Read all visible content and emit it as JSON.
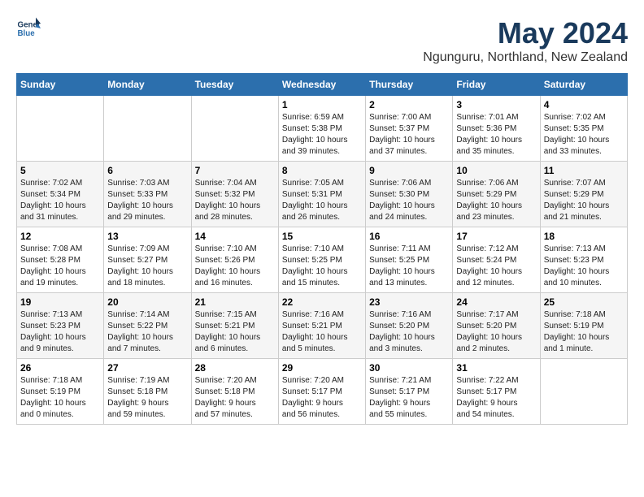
{
  "header": {
    "logo_line1": "General",
    "logo_line2": "Blue",
    "month": "May 2024",
    "location": "Ngunguru, Northland, New Zealand"
  },
  "weekdays": [
    "Sunday",
    "Monday",
    "Tuesday",
    "Wednesday",
    "Thursday",
    "Friday",
    "Saturday"
  ],
  "weeks": [
    [
      {
        "day": "",
        "info": ""
      },
      {
        "day": "",
        "info": ""
      },
      {
        "day": "",
        "info": ""
      },
      {
        "day": "1",
        "info": "Sunrise: 6:59 AM\nSunset: 5:38 PM\nDaylight: 10 hours\nand 39 minutes."
      },
      {
        "day": "2",
        "info": "Sunrise: 7:00 AM\nSunset: 5:37 PM\nDaylight: 10 hours\nand 37 minutes."
      },
      {
        "day": "3",
        "info": "Sunrise: 7:01 AM\nSunset: 5:36 PM\nDaylight: 10 hours\nand 35 minutes."
      },
      {
        "day": "4",
        "info": "Sunrise: 7:02 AM\nSunset: 5:35 PM\nDaylight: 10 hours\nand 33 minutes."
      }
    ],
    [
      {
        "day": "5",
        "info": "Sunrise: 7:02 AM\nSunset: 5:34 PM\nDaylight: 10 hours\nand 31 minutes."
      },
      {
        "day": "6",
        "info": "Sunrise: 7:03 AM\nSunset: 5:33 PM\nDaylight: 10 hours\nand 29 minutes."
      },
      {
        "day": "7",
        "info": "Sunrise: 7:04 AM\nSunset: 5:32 PM\nDaylight: 10 hours\nand 28 minutes."
      },
      {
        "day": "8",
        "info": "Sunrise: 7:05 AM\nSunset: 5:31 PM\nDaylight: 10 hours\nand 26 minutes."
      },
      {
        "day": "9",
        "info": "Sunrise: 7:06 AM\nSunset: 5:30 PM\nDaylight: 10 hours\nand 24 minutes."
      },
      {
        "day": "10",
        "info": "Sunrise: 7:06 AM\nSunset: 5:29 PM\nDaylight: 10 hours\nand 23 minutes."
      },
      {
        "day": "11",
        "info": "Sunrise: 7:07 AM\nSunset: 5:29 PM\nDaylight: 10 hours\nand 21 minutes."
      }
    ],
    [
      {
        "day": "12",
        "info": "Sunrise: 7:08 AM\nSunset: 5:28 PM\nDaylight: 10 hours\nand 19 minutes."
      },
      {
        "day": "13",
        "info": "Sunrise: 7:09 AM\nSunset: 5:27 PM\nDaylight: 10 hours\nand 18 minutes."
      },
      {
        "day": "14",
        "info": "Sunrise: 7:10 AM\nSunset: 5:26 PM\nDaylight: 10 hours\nand 16 minutes."
      },
      {
        "day": "15",
        "info": "Sunrise: 7:10 AM\nSunset: 5:25 PM\nDaylight: 10 hours\nand 15 minutes."
      },
      {
        "day": "16",
        "info": "Sunrise: 7:11 AM\nSunset: 5:25 PM\nDaylight: 10 hours\nand 13 minutes."
      },
      {
        "day": "17",
        "info": "Sunrise: 7:12 AM\nSunset: 5:24 PM\nDaylight: 10 hours\nand 12 minutes."
      },
      {
        "day": "18",
        "info": "Sunrise: 7:13 AM\nSunset: 5:23 PM\nDaylight: 10 hours\nand 10 minutes."
      }
    ],
    [
      {
        "day": "19",
        "info": "Sunrise: 7:13 AM\nSunset: 5:23 PM\nDaylight: 10 hours\nand 9 minutes."
      },
      {
        "day": "20",
        "info": "Sunrise: 7:14 AM\nSunset: 5:22 PM\nDaylight: 10 hours\nand 7 minutes."
      },
      {
        "day": "21",
        "info": "Sunrise: 7:15 AM\nSunset: 5:21 PM\nDaylight: 10 hours\nand 6 minutes."
      },
      {
        "day": "22",
        "info": "Sunrise: 7:16 AM\nSunset: 5:21 PM\nDaylight: 10 hours\nand 5 minutes."
      },
      {
        "day": "23",
        "info": "Sunrise: 7:16 AM\nSunset: 5:20 PM\nDaylight: 10 hours\nand 3 minutes."
      },
      {
        "day": "24",
        "info": "Sunrise: 7:17 AM\nSunset: 5:20 PM\nDaylight: 10 hours\nand 2 minutes."
      },
      {
        "day": "25",
        "info": "Sunrise: 7:18 AM\nSunset: 5:19 PM\nDaylight: 10 hours\nand 1 minute."
      }
    ],
    [
      {
        "day": "26",
        "info": "Sunrise: 7:18 AM\nSunset: 5:19 PM\nDaylight: 10 hours\nand 0 minutes."
      },
      {
        "day": "27",
        "info": "Sunrise: 7:19 AM\nSunset: 5:18 PM\nDaylight: 9 hours\nand 59 minutes."
      },
      {
        "day": "28",
        "info": "Sunrise: 7:20 AM\nSunset: 5:18 PM\nDaylight: 9 hours\nand 57 minutes."
      },
      {
        "day": "29",
        "info": "Sunrise: 7:20 AM\nSunset: 5:17 PM\nDaylight: 9 hours\nand 56 minutes."
      },
      {
        "day": "30",
        "info": "Sunrise: 7:21 AM\nSunset: 5:17 PM\nDaylight: 9 hours\nand 55 minutes."
      },
      {
        "day": "31",
        "info": "Sunrise: 7:22 AM\nSunset: 5:17 PM\nDaylight: 9 hours\nand 54 minutes."
      },
      {
        "day": "",
        "info": ""
      }
    ]
  ]
}
